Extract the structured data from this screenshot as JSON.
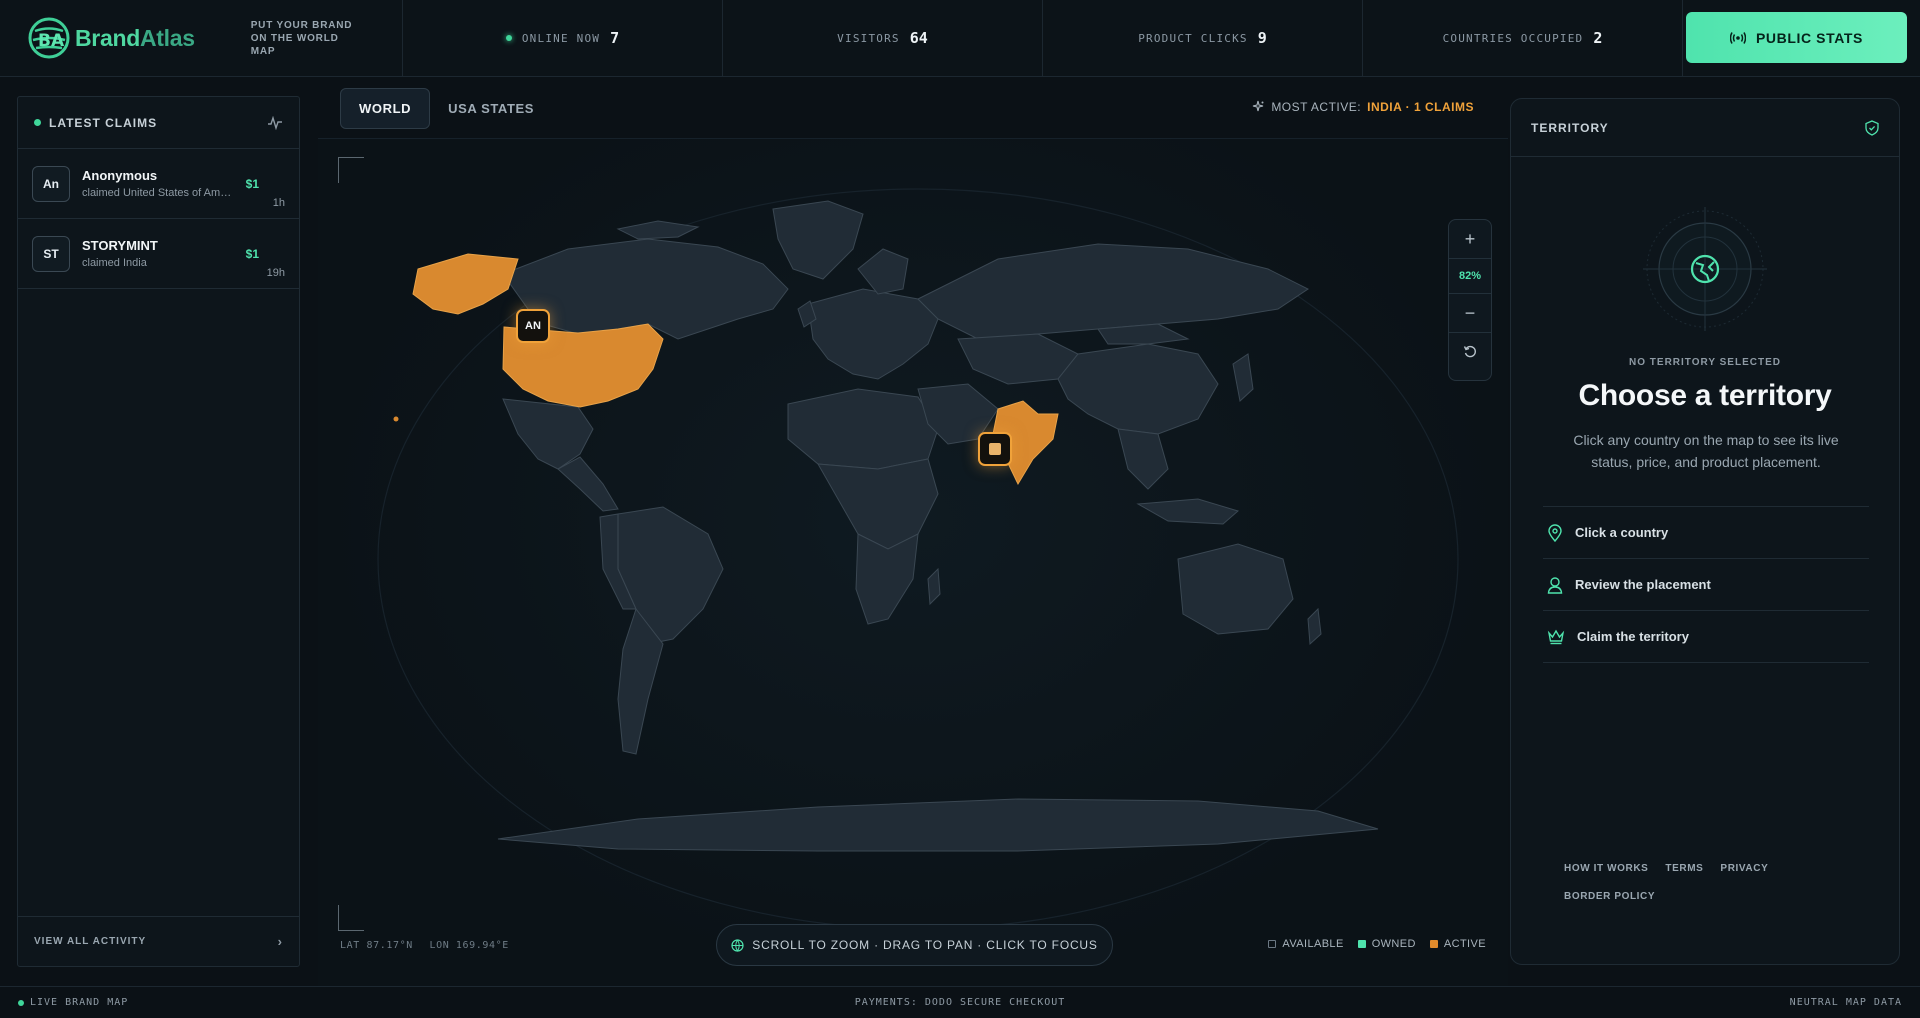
{
  "header": {
    "brand_a": "Brand",
    "brand_b": "Atlas",
    "tagline": "PUT YOUR BRAND ON THE WORLD MAP",
    "stats": [
      {
        "label": "ONLINE NOW",
        "value": "7"
      },
      {
        "label": "VISITORS",
        "value": "64"
      },
      {
        "label": "PRODUCT CLICKS",
        "value": "9"
      },
      {
        "label": "COUNTRIES OCCUPIED",
        "value": "2"
      }
    ],
    "public_stats_label": "PUBLIC STATS"
  },
  "claims_panel": {
    "title": "LATEST CLAIMS",
    "items": [
      {
        "initials": "An",
        "name": "Anonymous",
        "sub": "claimed United States of America",
        "price": "$1",
        "time": "1h"
      },
      {
        "initials": "ST",
        "name": "STORYMINT",
        "sub": "claimed India",
        "price": "$1",
        "time": "19h"
      }
    ],
    "view_all": "VIEW ALL ACTIVITY"
  },
  "map": {
    "tabs": [
      "WORLD",
      "USA STATES"
    ],
    "active_tab": "WORLD",
    "most_active_label": "MOST ACTIVE:",
    "most_active_value": "INDIA · 1 CLAIMS",
    "zoom_level": "82%",
    "markers": [
      {
        "label": "AN",
        "country": "United States of America"
      },
      {
        "label": "",
        "country": "India"
      }
    ],
    "lat": "LAT 87.17°N",
    "lon": "LON 169.94°E",
    "hint": "SCROLL TO ZOOM · DRAG TO PAN · CLICK TO FOCUS",
    "legend": [
      {
        "label": "AVAILABLE",
        "color": "#2a3540"
      },
      {
        "label": "OWNED",
        "color": "#4fe3ad"
      },
      {
        "label": "ACTIVE",
        "color": "#e08a2c"
      }
    ],
    "colors": {
      "land": "#222d37",
      "active": "#d9892f",
      "border": "#3a4752"
    }
  },
  "territory_panel": {
    "title": "TERRITORY",
    "kicker": "NO TERRITORY SELECTED",
    "heading": "Choose a territory",
    "description": "Click any country on the map to see its live status, price, and product placement.",
    "steps": [
      "Click a country",
      "Review the placement",
      "Claim the territory"
    ],
    "links": [
      "HOW IT WORKS",
      "TERMS",
      "PRIVACY",
      "BORDER POLICY"
    ]
  },
  "footer": {
    "left": "LIVE BRAND MAP",
    "center": "PAYMENTS: DODO SECURE CHECKOUT",
    "right": "NEUTRAL MAP DATA"
  }
}
